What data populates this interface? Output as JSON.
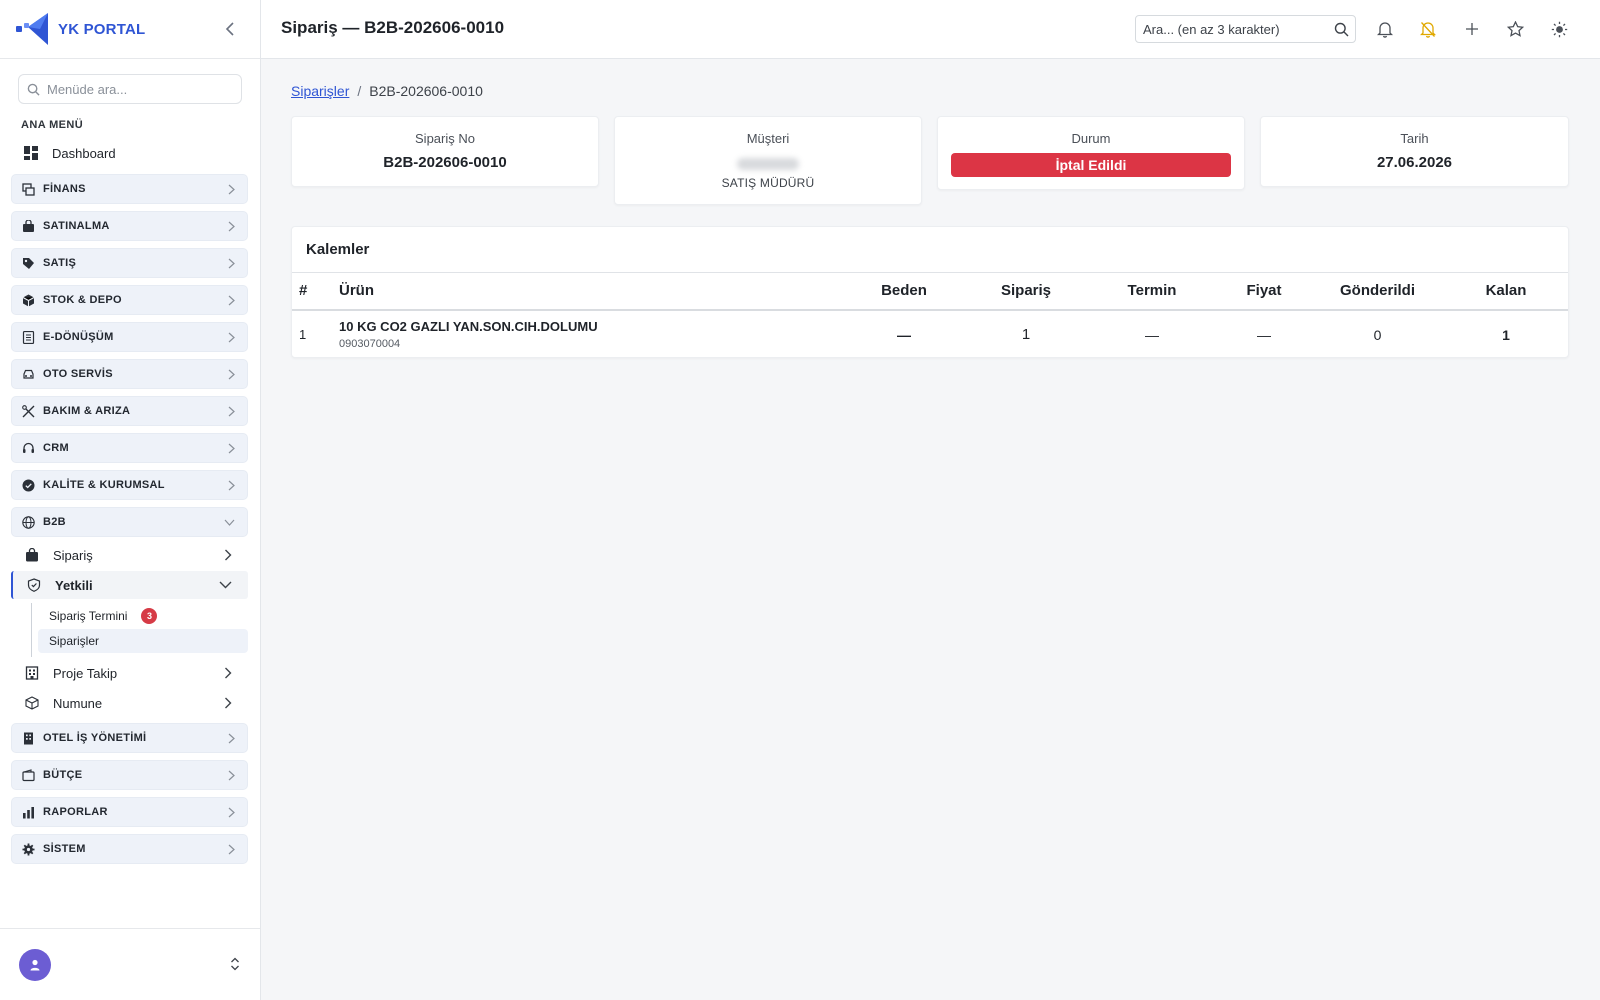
{
  "brand": {
    "title": "YK PORTAL"
  },
  "sidebar": {
    "search_placeholder": "Menüde ara...",
    "section_title": "ANA MENÜ",
    "dashboard_label": "Dashboard",
    "groups": {
      "finans": "FİNANS",
      "satinalma": "SATINALMA",
      "satis": "SATIŞ",
      "stok": "STOK & DEPO",
      "edonusum": "E-DÖNÜŞÜM",
      "otoservis": "OTO SERVİS",
      "bakim": "BAKIM & ARIZA",
      "crm": "CRM",
      "kalite": "KALİTE & KURUMSAL",
      "b2b": "B2B",
      "otel": "OTEL İŞ YÖNETİMİ",
      "butce": "BÜTÇE",
      "raporlar": "RAPORLAR",
      "sistem": "SİSTEM"
    },
    "b2b_items": {
      "siparis": "Sipariş",
      "yetkili": "Yetkili",
      "proje_takip": "Proje Takip",
      "numune": "Numune"
    },
    "yetkili_leaves": {
      "siparis_termini": "Sipariş Termini",
      "siparis_termini_badge": "3",
      "siparisler": "Siparişler"
    }
  },
  "header": {
    "title": "Sipariş — B2B-202606-0010",
    "search_placeholder": "Ara... (en az 3 karakter)"
  },
  "breadcrumb": {
    "parent": "Siparişler",
    "sep": "/",
    "current": "B2B-202606-0010"
  },
  "summary": {
    "order_no_label": "Sipariş No",
    "order_no": "B2B-202606-0010",
    "customer_label": "Müşteri",
    "customer_role": "SATIŞ MÜDÜRÜ",
    "status_label": "Durum",
    "status": "İptal Edildi",
    "date_label": "Tarih",
    "date": "27.06.2026"
  },
  "items": {
    "title": "Kalemler",
    "columns": [
      "#",
      "Ürün",
      "Beden",
      "Sipariş",
      "Termin",
      "Fiyat",
      "Gönderildi",
      "Kalan"
    ],
    "rows": [
      {
        "no": "1",
        "name": "10 KG CO2 GAZLI YAN.SON.CIH.DOLUMU",
        "code": "0903070004",
        "beden": "—",
        "siparis": "1",
        "termin": "—",
        "fiyat": "—",
        "gonderildi": "0",
        "kalan": "1"
      }
    ]
  },
  "colors": {
    "accent": "#2f55d4",
    "danger": "#dc3545",
    "warning": "#e8a300",
    "badge": "#d63b46",
    "avatar": "#6c5dd3"
  },
  "icons": [
    "logo-icon",
    "collapse-icon",
    "search-icon",
    "dashboard-icon",
    "finance-icon",
    "bag-icon",
    "tag-icon",
    "box-icon",
    "document-icon",
    "car-icon",
    "tools-icon",
    "headset-icon",
    "check-badge-icon",
    "globe-icon",
    "shopping-bag-icon",
    "shield-icon",
    "building-icon",
    "cube-icon",
    "hotel-icon",
    "wallet-icon",
    "bar-chart-icon",
    "gear-icon",
    "user-icon",
    "updown-icon",
    "bell-icon",
    "bell-off-icon",
    "plus-icon",
    "star-icon",
    "sun-icon"
  ]
}
